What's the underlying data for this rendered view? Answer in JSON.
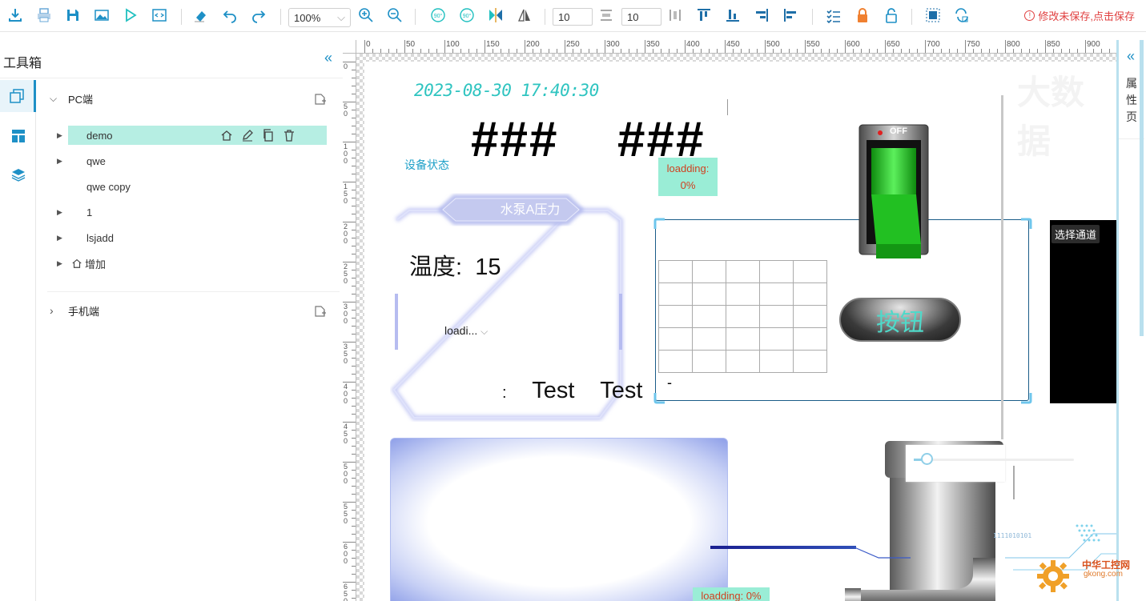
{
  "toolbar": {
    "zoom": "100%",
    "spacing_a": "10",
    "spacing_b": "10",
    "unsaved_notice": "修改未保存,点击保存",
    "unsaved_icon": "!"
  },
  "toolbox": {
    "title": "工具箱",
    "collapse_glyph": "«",
    "groups": [
      {
        "label": "PC端",
        "expanded": true,
        "items": [
          {
            "label": "demo",
            "selected": true,
            "has_children": true
          },
          {
            "label": "qwe",
            "has_children": true
          },
          {
            "label": "qwe copy",
            "has_children": false
          },
          {
            "label": "1",
            "has_children": true
          },
          {
            "label": "lsjadd",
            "has_children": true
          },
          {
            "label": "增加",
            "has_children": true,
            "icon": "home-icon"
          }
        ]
      },
      {
        "label": "手机端",
        "expanded": false
      }
    ]
  },
  "canvas": {
    "ruler_top_ticks": [
      "0",
      "50",
      "100",
      "150",
      "200",
      "250",
      "300",
      "350",
      "400",
      "450",
      "500",
      "550",
      "600",
      "650",
      "700",
      "750",
      "800",
      "850",
      "900"
    ],
    "ruler_left_ticks": [
      "0",
      "50",
      "100",
      "150",
      "200",
      "250",
      "300",
      "350",
      "400",
      "450",
      "500",
      "550",
      "600",
      "650"
    ],
    "datetime": "2023-08-30 17:40:30",
    "hash_1": "###",
    "hash_2": "###",
    "device_status": "设备状态",
    "loading_1_line1": "loadding:",
    "loading_1_line2": "0%",
    "pressure_title": "水泵A压力",
    "temperature_label": "温度:",
    "temperature_value": "15",
    "loading_select": "loadi...",
    "test_colon": ":",
    "test_1": "Test",
    "test_2": "Test",
    "button_label": "按钮",
    "switch_label": "OFF",
    "channel_button": "选择通道",
    "dash": "-",
    "loading_2": "loadding: 0%",
    "slider_value": 0.08,
    "watermark_text": "大数据",
    "logo_text_1": "中华工控网",
    "logo_text_2": "gkong.com",
    "binary_text": "1111010101"
  },
  "right_panel": {
    "collapse_glyph": "«",
    "tab_label": "属性页"
  },
  "colors": {
    "accent": "#1e90c6",
    "selection": "#b6eee3",
    "cyan_text": "#2ec4c0",
    "loading_bg": "#9aedd6",
    "error": "#e04040"
  }
}
